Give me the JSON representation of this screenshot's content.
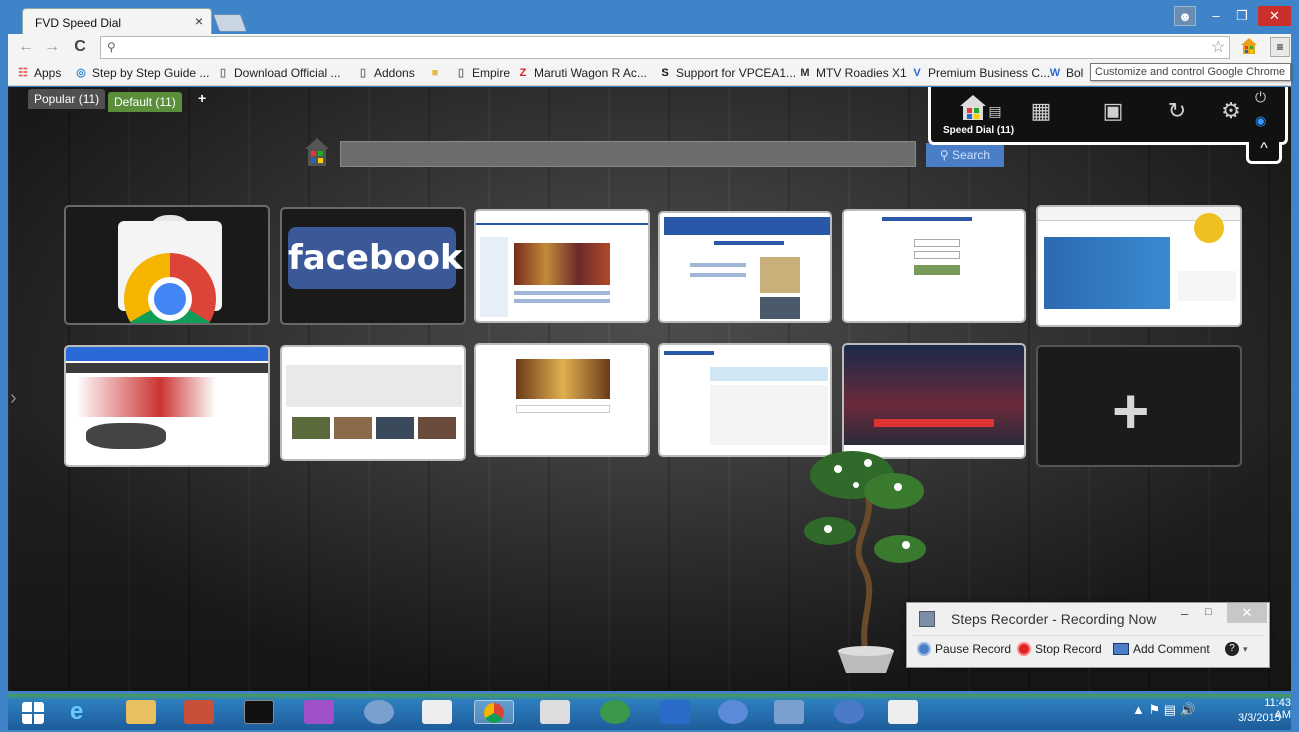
{
  "window": {
    "tab_title": "FVD Speed Dial",
    "tab_close": "×"
  },
  "toolbar": {
    "back": "←",
    "forward": "→",
    "reload": "C",
    "omnibox_value": "",
    "menu_glyph": "≡"
  },
  "bookmarks": [
    {
      "label": "Apps",
      "icon": "apps-grid-icon"
    },
    {
      "label": "Step by Step Guide ...",
      "icon": "globe-icon"
    },
    {
      "label": "Download Official ...",
      "icon": "page-icon"
    },
    {
      "label": "Addons",
      "icon": "page-icon"
    },
    {
      "label": "",
      "icon": "folder-icon"
    },
    {
      "label": "Empire",
      "icon": "page-icon"
    },
    {
      "label": "Maruti Wagon R Ac...",
      "icon": "zigwheels-icon"
    },
    {
      "label": "Support for VPCEA1...",
      "icon": "sony-icon"
    },
    {
      "label": "MTV Roadies X1",
      "icon": "mtv-icon"
    },
    {
      "label": "Premium Business C...",
      "icon": "vistaprint-icon"
    },
    {
      "label": "Bol",
      "icon": "wikipedia-icon"
    }
  ],
  "tooltip": "Customize and control Google Chrome",
  "speed_dial": {
    "groups": [
      {
        "label": "Popular (11)"
      },
      {
        "label": "Default (11)"
      }
    ],
    "add_group": "+",
    "search_button": "Search",
    "panel_label": "Speed Dial (11)",
    "collapse": "^",
    "dials_row1": [
      {
        "name": "chrome-web-store"
      },
      {
        "name": "facebook",
        "text": "facebook"
      },
      {
        "name": "iiitdm-jabalpur"
      },
      {
        "name": "iiitdm-computer-centre"
      },
      {
        "name": "login-page"
      },
      {
        "name": "ebay"
      }
    ],
    "dials_row2": [
      {
        "name": "flipkart"
      },
      {
        "name": "youtube"
      },
      {
        "name": "google-doodle"
      },
      {
        "name": "extratorrent"
      },
      {
        "name": "cricinfo"
      },
      {
        "name": "add-dial",
        "text": "+"
      }
    ]
  },
  "steps_recorder": {
    "title": "Steps Recorder - Recording Now",
    "pause": "Pause Record",
    "stop": "Stop Record",
    "comment": "Add Comment",
    "help": "?"
  },
  "taskbar": {
    "time": "11:43 AM",
    "date": "3/3/2015"
  }
}
